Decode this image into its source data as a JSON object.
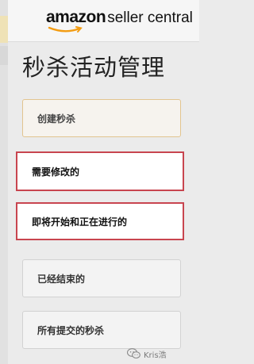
{
  "brand": {
    "amazon": "amazon",
    "rest": "seller central"
  },
  "page": {
    "title": "秒杀活动管理"
  },
  "menu": {
    "items": [
      {
        "label": "创建秒杀"
      },
      {
        "label": "需要修改的"
      },
      {
        "label": "即将开始和正在进行的"
      },
      {
        "label": "已经结束的"
      },
      {
        "label": "所有提交的秒杀"
      }
    ]
  },
  "watermark": {
    "text": "Kris浩"
  },
  "colors": {
    "highlight_border": "#c8454f",
    "brand_smile": "#f39c12"
  }
}
